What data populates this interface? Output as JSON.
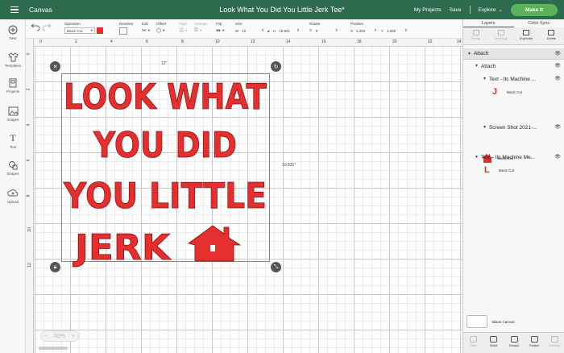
{
  "topbar": {
    "app_title": "Canvas",
    "doc_title": "Look What You Did You Little Jerk Tee*",
    "my_projects": "My Projects",
    "save": "Save",
    "explore": "Explore",
    "make_it": "Make It"
  },
  "leftbar": {
    "items": [
      {
        "label": "New",
        "icon": "plus-circle-icon"
      },
      {
        "label": "Templates",
        "icon": "shirt-icon"
      },
      {
        "label": "Projects",
        "icon": "projects-icon"
      },
      {
        "label": "Images",
        "icon": "images-icon"
      },
      {
        "label": "Text",
        "icon": "text-icon"
      },
      {
        "label": "Shapes",
        "icon": "shapes-icon"
      },
      {
        "label": "Upload",
        "icon": "upload-icon"
      }
    ]
  },
  "toolbar": {
    "operation_label": "Operation",
    "operation_value": "Basic Cut",
    "operation_color": "#e52e2e",
    "deselect_label": "Deselect",
    "edit_label": "Edit",
    "offset_label": "Offset",
    "align_label": "Align",
    "arrange_label": "Arrange",
    "flip_label": "Flip",
    "size_label": "Size",
    "w_label": "W",
    "w_value": "12",
    "h_label": "H",
    "h_value": "10.821",
    "rotate_label": "Rotate",
    "rotate_value": "0",
    "position_label": "Position",
    "x_label": "X",
    "x_value": "1.283",
    "y_label": "Y",
    "y_value": "1.285"
  },
  "panel": {
    "tab_layers": "Layers",
    "tab_color_sync": "Color Sync",
    "actions": [
      "Group",
      "UnGroup",
      "Duplicate",
      "Delete"
    ],
    "layers": {
      "attach_top": "Attach",
      "attach_inner": "Attach",
      "text_1": "Text - Itc Machine ...",
      "text_1_sub": "Basic Cut",
      "screenshot": "Screen Shot 2021-...",
      "screenshot_sub": "Basic Cut",
      "text_2": "Text - Itc Machine Me...",
      "text_2_sub": "Basic Cut"
    },
    "blank_canvas": "Blank Canvas",
    "bottom_actions": [
      "Slice",
      "Weld",
      "Detach",
      "Flatten",
      "Contour"
    ]
  },
  "canvas": {
    "ruler_top": [
      "0",
      "2",
      "4",
      "6",
      "8",
      "10",
      "12",
      "14",
      "16",
      "18",
      "20",
      "22",
      "24"
    ],
    "ruler_left": [
      "0",
      "2",
      "4",
      "6",
      "8",
      "10",
      "12"
    ],
    "width_label": "12\"",
    "height_label": "10.821\"",
    "zoom": "50%",
    "design_lines": [
      "LOOK WHAT",
      "YOU DID",
      "YOU LITTLE",
      "JERK"
    ],
    "design_color": "#e52e2e"
  }
}
